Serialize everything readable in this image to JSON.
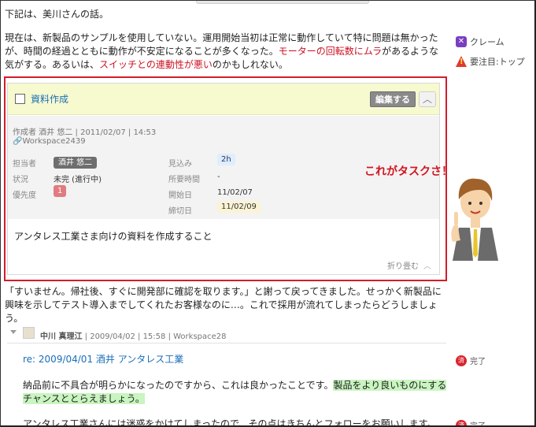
{
  "intro": "下記は、美川さんの話。",
  "para1": {
    "t1": "現在は、新製品のサンプルを使用していない。運用開始当初は正常に動作していて特に問題は無かったが、時間の経過とともに動作が不安定になることが多くなった。",
    "hl1": "モーターの回転数にムラ",
    "t2": "があるような気がする。あるいは、",
    "hl2": "スイッチとの連動性が悪い",
    "t3": "のかもしれない。"
  },
  "side_actions": [
    {
      "label": "クレーム",
      "icon": "claim-icon"
    },
    {
      "label": "要注目:トップ",
      "icon": "flag-icon"
    }
  ],
  "task": {
    "title": "資料作成",
    "edit_label": "編集する",
    "created_by": "作成者 酒井 悠二 | 2011/02/07 | 14:53",
    "workspace": "Workspace2439",
    "fields": {
      "assignee_label": "担当者",
      "assignee": "酒井 悠二",
      "status_label": "状況",
      "status": "未完 (進行中)",
      "priority_label": "優先度",
      "priority": "1",
      "estimate_label": "見込み",
      "estimate": "2h",
      "required_label": "所要時間",
      "required": "-",
      "start_label": "開始日",
      "start": "11/02/07",
      "due_label": "締切日",
      "due": "11/02/09"
    },
    "description": "アンタレス工業さま向けの資料を作成すること",
    "fold_label": "折り畳む"
  },
  "callout": "これがタスクさ！",
  "para2": "「すいません。帰社後、すぐに開発部に確認を取ります。」と謝って戻ってきました。せっかく新製品に興味を示してテスト導入までしてくれたお客様なのに…。これで採用が流れてしまったらどうしましょう。",
  "comment": {
    "author": "中川 真理江",
    "meta_rest": " | 2009/04/02 | 15:58 | Workspace28",
    "reply": "re: 2009/04/01 酒井 アンタレス工業",
    "body1_t1": "納品前に不具合が明らかになったのですから、これは良かったことです。",
    "body1_hl": "製品をより良いものにするチャンスととらえましょう。",
    "body2": "アンタレス工業さんには迷惑をかけてしまったので、その点はきちんとフォローをお願いします。",
    "done_label": "完了"
  },
  "colors": {
    "accent_red": "#d21d2b",
    "link_blue": "#1a6fb8",
    "highlight_green": "#c9f5c0",
    "task_header": "#f7f9cf"
  }
}
